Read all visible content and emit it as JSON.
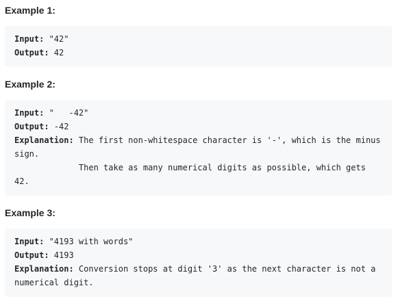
{
  "examples": [
    {
      "heading": "Example 1:",
      "input_label": "Input:",
      "input_value": " \"42\"",
      "output_label": "Output:",
      "output_value": " 42"
    },
    {
      "heading": "Example 2:",
      "input_label": "Input:",
      "input_value": " \"   -42\"",
      "output_label": "Output:",
      "output_value": " -42",
      "explanation_label": "Explanation:",
      "explanation_line1": " The first non-whitespace character is '-', which is the minus",
      "explanation_line2": "sign.",
      "explanation_line3": "             Then take as many numerical digits as possible, which gets",
      "explanation_line4": "42."
    },
    {
      "heading": "Example 3:",
      "input_label": "Input:",
      "input_value": " \"4193 with words\"",
      "output_label": "Output:",
      "output_value": " 4193",
      "explanation_label": "Explanation:",
      "explanation_line1": " Conversion stops at digit '3' as the next character is not a",
      "explanation_line2": "numerical digit."
    }
  ]
}
